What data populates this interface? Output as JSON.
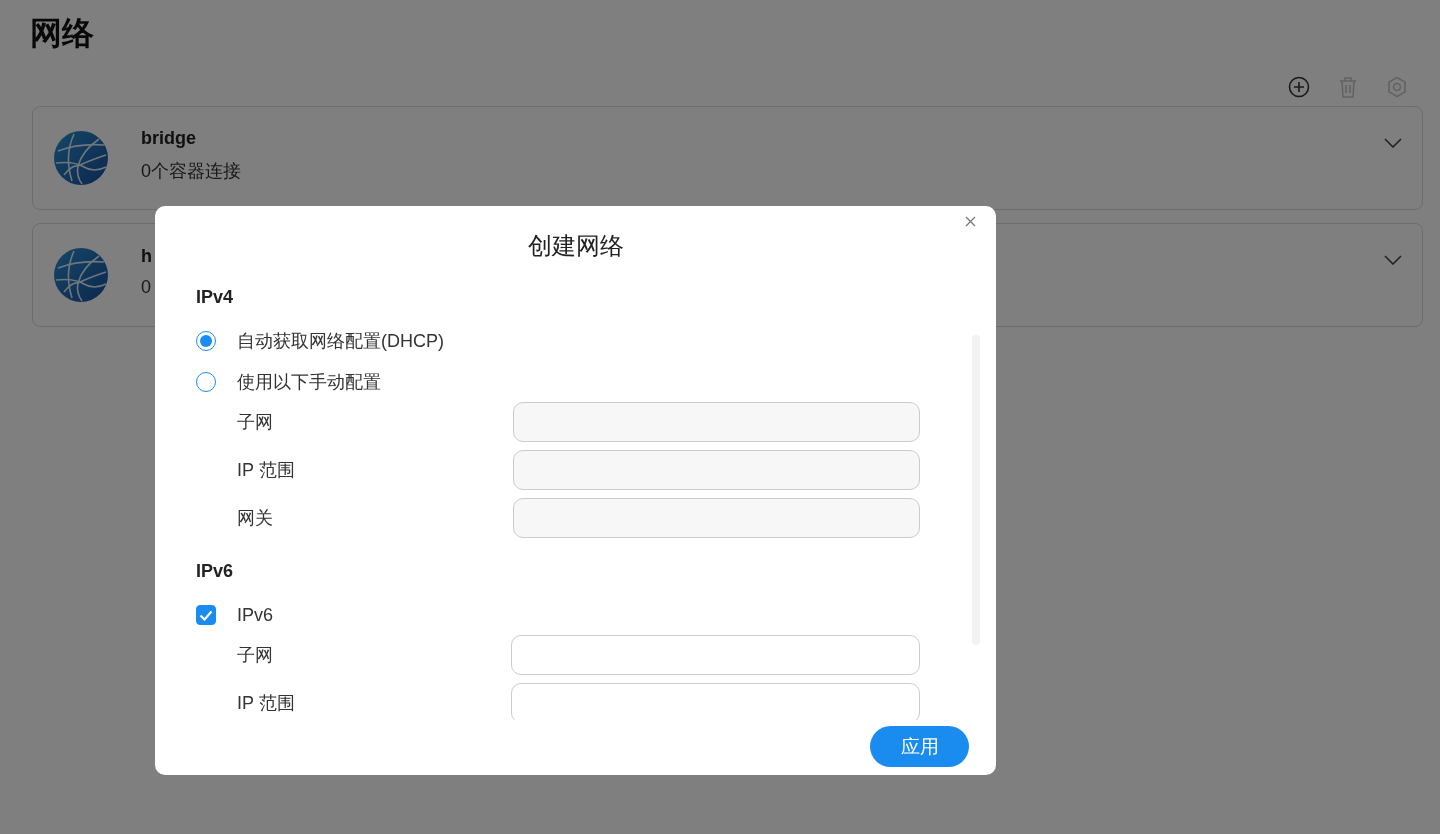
{
  "page": {
    "title": "网络"
  },
  "toolbar": [
    {
      "kind": "add",
      "disabled": false
    },
    {
      "kind": "delete",
      "disabled": true
    },
    {
      "kind": "settings",
      "disabled": true
    }
  ],
  "networks": [
    {
      "name": "bridge",
      "subtitle": "0个容器连接",
      "expanded": false
    },
    {
      "name": "h",
      "subtitle": "0",
      "expanded": false
    }
  ],
  "dialog": {
    "title": "创建网络",
    "sections": [
      {
        "heading": "IPv4",
        "options": [
          {
            "kind": "radio",
            "label": "自动获取网络配置(DHCP)",
            "selected": true
          },
          {
            "kind": "radio",
            "label": "使用以下手动配置",
            "selected": false
          }
        ],
        "fields": [
          {
            "label": "子网",
            "disabled": true
          },
          {
            "label": "IP 范围",
            "disabled": true
          },
          {
            "label": "网关",
            "disabled": true
          }
        ]
      },
      {
        "heading": "IPv6",
        "options": [
          {
            "kind": "checkbox",
            "label": "IPv6",
            "checked": true
          }
        ],
        "fields": [
          {
            "label": "子网",
            "disabled": false
          },
          {
            "label": "IP 范围",
            "disabled": false
          }
        ]
      }
    ],
    "apply_button": "应用"
  }
}
